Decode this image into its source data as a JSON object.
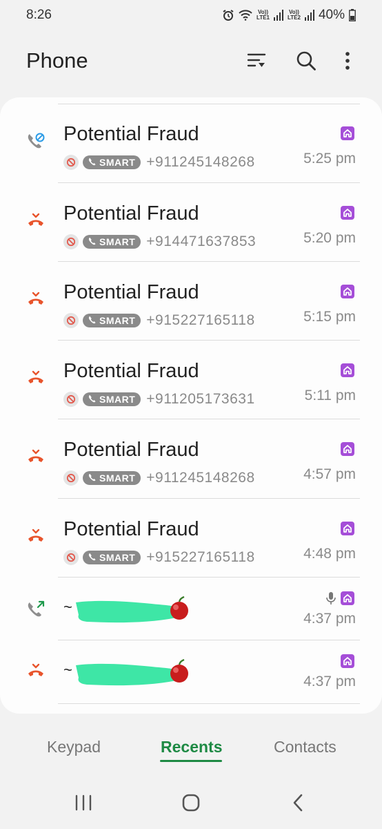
{
  "status_bar": {
    "time": "8:26",
    "battery": "40%",
    "sim1_top": "Vo))",
    "sim1_bottom": "LTE1",
    "sim2_top": "Vo))",
    "sim2_bottom": "LTE2"
  },
  "header": {
    "title": "Phone"
  },
  "calls": [
    {
      "name": "Potential Fraud",
      "badge": "SMART",
      "number": "+911245148268",
      "time": "5:25 pm",
      "type": "blocked-call-icon"
    },
    {
      "name": "Potential Fraud",
      "badge": "SMART",
      "number": "+914471637853",
      "time": "5:20 pm",
      "type": "rejected-call-icon"
    },
    {
      "name": "Potential Fraud",
      "badge": "SMART",
      "number": "+915227165118",
      "time": "5:15 pm",
      "type": "rejected-call-icon"
    },
    {
      "name": "Potential Fraud",
      "badge": "SMART",
      "number": "+911205173631",
      "time": "5:11 pm",
      "type": "rejected-call-icon"
    },
    {
      "name": "Potential Fraud",
      "badge": "SMART",
      "number": "+911245148268",
      "time": "4:57 pm",
      "type": "rejected-call-icon"
    },
    {
      "name": "Potential Fraud",
      "badge": "SMART",
      "number": "+915227165118",
      "time": "4:48 pm",
      "type": "rejected-call-icon"
    },
    {
      "name": "~",
      "time": "4:37 pm",
      "type": "outgoing-call-icon"
    },
    {
      "name": "~",
      "time": "4:37 pm",
      "type": "rejected-call-icon"
    }
  ],
  "tabs": {
    "keypad": "Keypad",
    "recents": "Recents",
    "contacts": "Contacts"
  },
  "colors": {
    "accent": "#1e8a44",
    "rejected": "#e8542c",
    "sim": "#a54ed8",
    "smart_badge": "#8a8a8a"
  }
}
